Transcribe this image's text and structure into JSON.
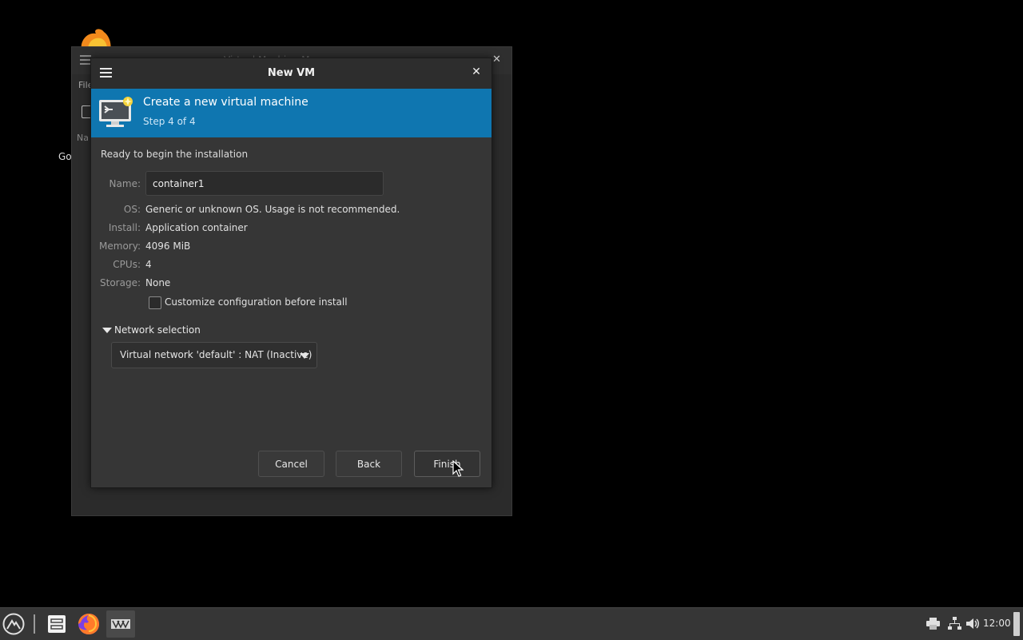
{
  "desktop": {
    "icon_label": "Go"
  },
  "background_window": {
    "title": "Virtual Machine Manager",
    "menu_file": "File",
    "column_name": "Na",
    "row_mark": "l"
  },
  "dialog": {
    "title": "New VM",
    "banner": {
      "title": "Create a new virtual machine",
      "step": "Step 4 of 4"
    },
    "ready_text": "Ready to begin the installation",
    "fields": {
      "name_label": "Name:",
      "name_value": "container1",
      "os_label": "OS:",
      "os_value": "Generic or unknown OS. Usage is not recommended.",
      "install_label": "Install:",
      "install_value": "Application container",
      "memory_label": "Memory:",
      "memory_value": "4096 MiB",
      "cpus_label": "CPUs:",
      "cpus_value": "4",
      "storage_label": "Storage:",
      "storage_value": "None"
    },
    "customize_checkbox": {
      "label": "Customize configuration before install",
      "checked": false
    },
    "network": {
      "expander_label": "Network selection",
      "expanded": true,
      "selected": "Virtual network 'default' : NAT (Inactive)"
    },
    "buttons": {
      "cancel": "Cancel",
      "back": "Back",
      "finish": "Finish"
    },
    "accent_color": "#0f76b0"
  },
  "taskbar": {
    "clock": "12:00",
    "icons": [
      "start-menu-icon",
      "file-manager-icon",
      "firefox-icon",
      "virt-manager-icon",
      "printer-icon",
      "network-icon",
      "volume-icon"
    ]
  }
}
